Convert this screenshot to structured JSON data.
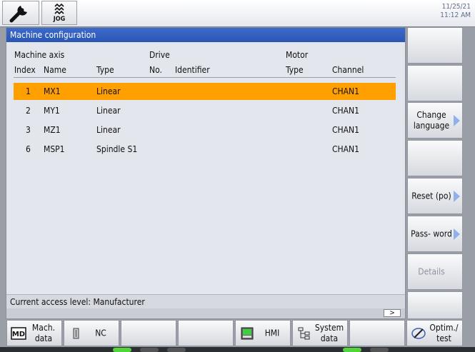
{
  "topbar": {
    "jog_label": "JOG",
    "date": "11/25/21",
    "time": "11:12 AM"
  },
  "panel": {
    "title": "Machine configuration",
    "groups": {
      "axis": "Machine axis",
      "drive": "Drive",
      "motor": "Motor"
    },
    "columns": {
      "index": "Index",
      "name": "Name",
      "type": "Type",
      "no": "No.",
      "identifier": "Identifier",
      "motor_type": "Type",
      "channel": "Channel"
    },
    "rows": [
      {
        "index": "1",
        "name": "MX1",
        "type": "Linear",
        "channel": "CHAN1",
        "selected": true
      },
      {
        "index": "2",
        "name": "MY1",
        "type": "Linear",
        "channel": "CHAN1",
        "selected": false
      },
      {
        "index": "3",
        "name": "MZ1",
        "type": "Linear",
        "channel": "CHAN1",
        "selected": false
      },
      {
        "index": "6",
        "name": "MSP1",
        "type": "Spindle S1",
        "channel": "CHAN1",
        "selected": false
      }
    ],
    "status": "Current access level: Manufacturer",
    "scroll_arrow": ">"
  },
  "vsoftkeys": [
    {
      "label": "",
      "arrow": false,
      "disabled": false
    },
    {
      "label": "",
      "arrow": false,
      "disabled": false
    },
    {
      "label": "Change language",
      "arrow": true,
      "disabled": false
    },
    {
      "label": "",
      "arrow": false,
      "disabled": false
    },
    {
      "label": "Reset (po)",
      "arrow": true,
      "disabled": false
    },
    {
      "label": "Pass- word",
      "arrow": true,
      "disabled": false
    },
    {
      "label": "Details",
      "arrow": false,
      "disabled": true
    },
    {
      "label": "",
      "arrow": false,
      "disabled": false
    }
  ],
  "hsoftkeys": {
    "mach_data": "Mach. data",
    "nc": "NC",
    "hmi": "HMI",
    "system_data": "System data",
    "optim_test": "Optim./ test"
  },
  "colors": {
    "selection": "#ffa000",
    "title_bar": "#2a56b4",
    "arrow": "#8fb0e8"
  }
}
